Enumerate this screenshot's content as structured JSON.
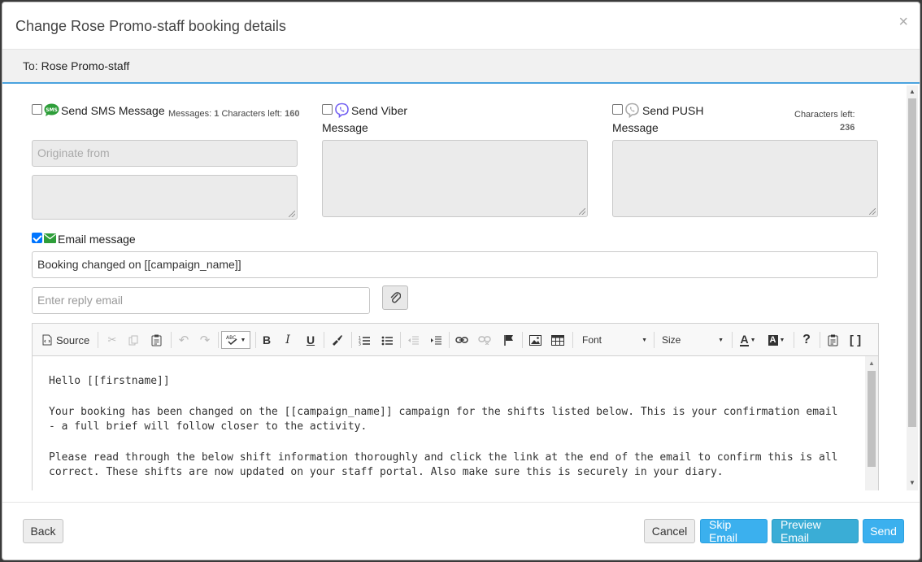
{
  "modal": {
    "title": "Change Rose Promo-staff booking details",
    "close_glyph": "×",
    "to_label": "To:",
    "to_name": "Rose Promo-staff"
  },
  "sms": {
    "checked": false,
    "label": "Send SMS Message",
    "messages_label": "Messages:",
    "messages_count": "1",
    "chars_label": "Characters left:",
    "chars_left": "160",
    "originate_placeholder": "Originate from",
    "body_value": ""
  },
  "viber": {
    "checked": false,
    "label_line1": "Send Viber",
    "label_line2": "Message",
    "body_value": ""
  },
  "push": {
    "checked": false,
    "label_line1": "Send PUSH",
    "label_line2": "Message",
    "chars_label": "Characters left:",
    "chars_left": "236",
    "body_value": ""
  },
  "email": {
    "checked": true,
    "label": "Email message",
    "subject_value": "Booking changed on [[campaign_name]]",
    "reply_placeholder": "Enter reply email"
  },
  "editor": {
    "toolbar": {
      "source_label": "Source",
      "font_label": "Font",
      "size_label": "Size"
    },
    "paragraphs": [
      "Hello [[firstname]]",
      "Your booking has been changed on the [[campaign_name]] campaign for the shifts listed below. This is your confirmation email - a full brief will follow closer to the activity.",
      "Please read through the below shift information thoroughly and click the link at the end of the email to confirm this is all correct. These shifts are now updated on your staff portal. Also make sure this is securely in your diary."
    ]
  },
  "footer": {
    "back_label": "Back",
    "cancel_label": "Cancel",
    "skip_label": "Skip Email",
    "preview_label": "Preview Email",
    "send_label": "Send"
  },
  "colors": {
    "accent_blue": "#3bb0ee",
    "sms_green": "#2e9e3a",
    "email_green": "#2e9e3a",
    "viber_purple": "#7360f2",
    "checkbox_blue": "#0075ff"
  }
}
